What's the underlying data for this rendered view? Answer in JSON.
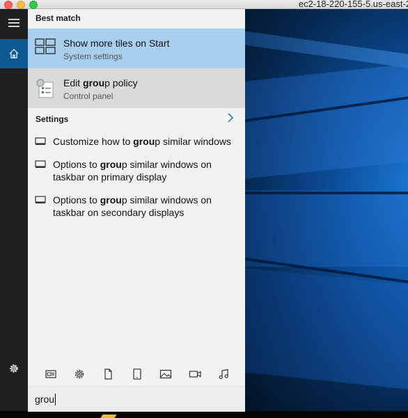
{
  "window": {
    "title": "ec2-18-220-155-5.us-east-2"
  },
  "rail": {
    "menu_icon": "hamburger-icon",
    "home_icon": "home-icon",
    "settings_icon": "gear-icon",
    "accent": "#0c5a91"
  },
  "search": {
    "best_match_heading": "Best match",
    "results": [
      {
        "title": "Show more tiles on Start",
        "subtitle": "System settings",
        "icon": "tiles-icon"
      },
      {
        "title": "Edit group policy",
        "subtitle": "Control panel",
        "icon": "group-policy-icon"
      }
    ],
    "settings_heading": "Settings",
    "settings_items": [
      {
        "text": "Customize how to group similar windows",
        "icon": "display-icon"
      },
      {
        "text": "Options to group similar windows on taskbar on primary display",
        "icon": "display-icon"
      },
      {
        "text": "Options to group similar windows on taskbar on secondary displays",
        "icon": "display-icon"
      }
    ],
    "filters": [
      "apps-icon",
      "gear-icon",
      "document-icon",
      "tablet-icon",
      "photo-icon",
      "video-icon",
      "music-icon"
    ],
    "query": "grou",
    "selected_color": "#a8cfee"
  }
}
